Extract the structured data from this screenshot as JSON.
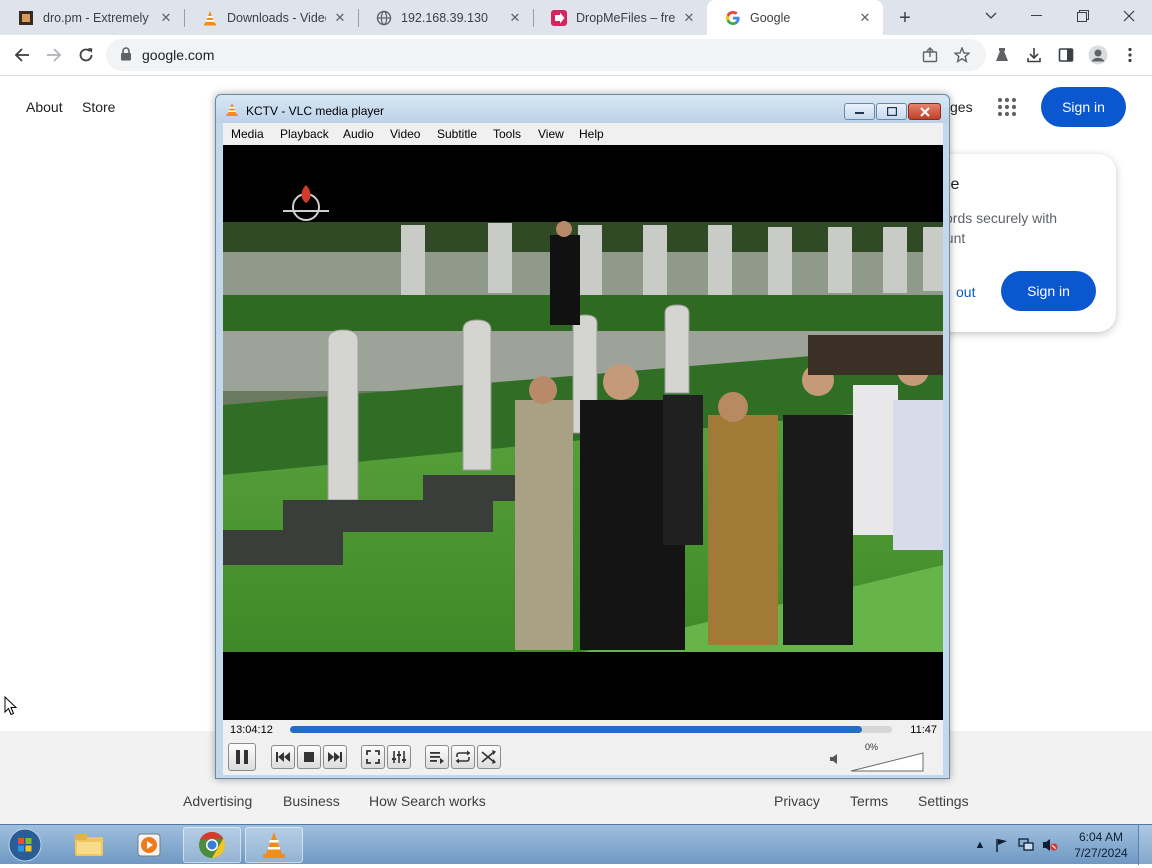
{
  "browser": {
    "tabs": [
      {
        "title": "dro.pm - Extremely",
        "favicon": "dropm-icon"
      },
      {
        "title": "Downloads - VideoL",
        "favicon": "vlc-cone-icon"
      },
      {
        "title": "192.168.39.130",
        "favicon": "globe-icon"
      },
      {
        "title": "DropMeFiles – free",
        "favicon": "dropmefiles-icon"
      },
      {
        "title": "Google",
        "favicon": "google-g-icon",
        "active": true
      }
    ],
    "url": "google.com"
  },
  "google": {
    "about": "About",
    "store": "Store",
    "images_partial": "ges",
    "sign_in": "Sign in",
    "card": {
      "title_partial": "gle",
      "body_line1": "vords securely with",
      "body_line2": "ount",
      "stay_out_partial": "out",
      "sign_in": "Sign in"
    },
    "footer": {
      "advertising": "Advertising",
      "business": "Business",
      "how_search_works": "How Search works",
      "privacy": "Privacy",
      "terms": "Terms",
      "settings": "Settings"
    }
  },
  "vlc": {
    "title": "KCTV - VLC media player",
    "menu": [
      "Media",
      "Playback",
      "Audio",
      "Video",
      "Subtitle",
      "Tools",
      "View",
      "Help"
    ],
    "elapsed": "13:04:12",
    "remaining": "11:47",
    "progress_fraction": 0.95,
    "volume": "0%",
    "volume_fraction": 0.0
  },
  "taskbar": {
    "apps": [
      "windows-explorer",
      "media-player",
      "chrome",
      "vlc"
    ],
    "time": "6:04 AM",
    "date": "7/27/2024"
  },
  "colors": {
    "google_blue": "#0b57d0",
    "vlc_progress": "#1f6fc5",
    "tab_strip": "#dfe3eb"
  }
}
